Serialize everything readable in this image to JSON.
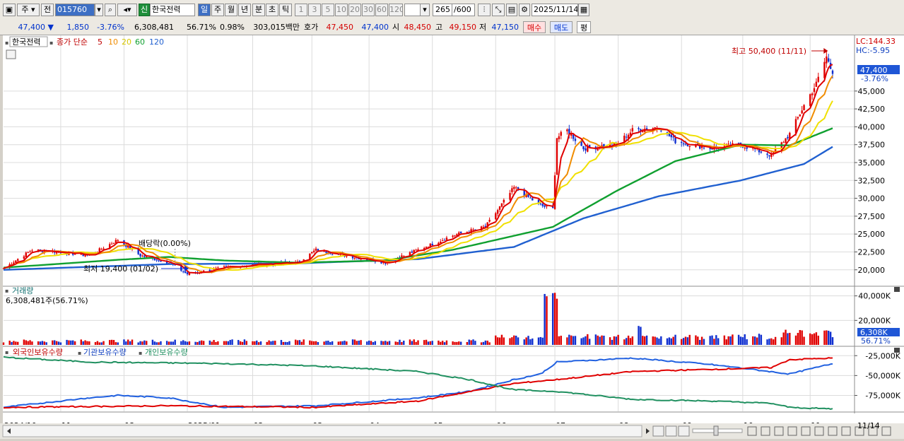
{
  "toolbar": {
    "mode_label": "주",
    "compare_label": "전",
    "code": "015760",
    "sin_badge": "신",
    "name": "한국전력",
    "periods": [
      "일",
      "주",
      "월",
      "년",
      "분",
      "초",
      "틱"
    ],
    "active_period": "일",
    "intervals": [
      "1",
      "3",
      "5",
      "10",
      "20",
      "30",
      "60",
      "120"
    ],
    "count": "265",
    "count_total": "/600",
    "date": "2025/11/14"
  },
  "quote": {
    "price": "47,400",
    "change": "1,850",
    "change_rate": "-3.76%",
    "volume": "6,308,481",
    "volume_ratio": "56.71%",
    "turnover_rate": "0.98%",
    "amount": "303,015백만",
    "hoga_label": "호가",
    "ask": "47,450",
    "bid": "47,400",
    "open_label": "시",
    "open": "48,450",
    "high_label": "고",
    "high": "49,150",
    "low_label": "저",
    "low": "47,150",
    "buy_label": "매수",
    "sell_label": "매도",
    "eval_label": "평"
  },
  "price_panel": {
    "stock_label": "한국전력",
    "ma_label": "종가 단순",
    "ma_periods": [
      "5",
      "10",
      "20",
      "60",
      "120"
    ],
    "lc": "LC:144.33",
    "hc": "HC:-5.95",
    "last_price": "47,400",
    "last_change": "-3.76%",
    "max_note": "최고 50,400 (11/11)",
    "min_note": "최저 19,400 (01/02)",
    "dividend_note": "배당락(0.00%)"
  },
  "volume_panel": {
    "title": "거래량",
    "value_text": "6,308,481주(56.71%)",
    "last_label": "6,308K",
    "last_ratio": "56.71%"
  },
  "investor_panel": {
    "titles": [
      "외국인보유수량",
      "기관보유수량",
      "개인보유수량"
    ]
  },
  "colors": {
    "ma5": "#e00000",
    "ma10": "#f08c00",
    "ma20": "#f0e000",
    "ma60": "#10a030",
    "ma120": "#2060d0",
    "up": "#e00000",
    "down": "#1030d0",
    "foreign": "#2060e0",
    "inst": "#e00000",
    "indiv": "#209060"
  },
  "chart_data": [
    {
      "type": "candlestick",
      "title": "한국전력",
      "y_ticks": [
        20000,
        22500,
        25000,
        27500,
        30000,
        32500,
        35000,
        37500,
        40000,
        42500,
        45000
      ],
      "ylim": [
        18000,
        52000
      ],
      "x_ticks": [
        "2024/10",
        "11",
        "12",
        "2025/01",
        "02",
        "03",
        "04",
        "05",
        "06",
        "07",
        "08",
        "09",
        "10",
        "11"
      ],
      "x_end_label": "11/14",
      "close_anchors": [
        [
          "2024/10/04",
          20200
        ],
        [
          "2024/10/18",
          22800
        ],
        [
          "2024/10/31",
          22500
        ],
        [
          "2024/11/15",
          22000
        ],
        [
          "2024/11/29",
          24200
        ],
        [
          "2024/12/10",
          22000
        ],
        [
          "2024/12/24",
          21000
        ],
        [
          "2025/01/02",
          19400
        ],
        [
          "2025/01/20",
          20300
        ],
        [
          "2025/02/05",
          20800
        ],
        [
          "2025/02/25",
          21000
        ],
        [
          "2025/03/06",
          22800
        ],
        [
          "2025/03/20",
          22000
        ],
        [
          "2025/04/09",
          21000
        ],
        [
          "2025/04/25",
          22800
        ],
        [
          "2025/05/12",
          24800
        ],
        [
          "2025/05/28",
          26000
        ],
        [
          "2025/06/11",
          31500
        ],
        [
          "2025/06/24",
          29000
        ],
        [
          "2025/06/30",
          28500
        ],
        [
          "2025/07/02",
          38500
        ],
        [
          "2025/07/07",
          39500
        ],
        [
          "2025/07/15",
          37000
        ],
        [
          "2025/07/31",
          37500
        ],
        [
          "2025/08/08",
          39500
        ],
        [
          "2025/08/21",
          40000
        ],
        [
          "2025/08/29",
          38000
        ],
        [
          "2025/09/15",
          37000
        ],
        [
          "2025/09/30",
          37500
        ],
        [
          "2025/10/15",
          36000
        ],
        [
          "2025/10/24",
          39000
        ],
        [
          "2025/10/31",
          43000
        ],
        [
          "2025/11/06",
          46000
        ],
        [
          "2025/11/11",
          49800
        ],
        [
          "2025/11/14",
          47400
        ]
      ],
      "ma60_anchors": [
        [
          "2024/10/04",
          20300
        ],
        [
          "2024/11/29",
          21400
        ],
        [
          "2024/12/24",
          21800
        ],
        [
          "2025/01/20",
          21300
        ],
        [
          "2025/02/25",
          21000
        ],
        [
          "2025/04/09",
          21300
        ],
        [
          "2025/05/12",
          22800
        ],
        [
          "2025/06/30",
          26000
        ],
        [
          "2025/07/31",
          31000
        ],
        [
          "2025/08/29",
          35200
        ],
        [
          "2025/09/30",
          37500
        ],
        [
          "2025/10/24",
          37400
        ],
        [
          "2025/11/14",
          39800
        ]
      ],
      "ma120_anchors": [
        [
          "2024/10/04",
          20000
        ],
        [
          "2024/12/24",
          20800
        ],
        [
          "2025/02/25",
          20900
        ],
        [
          "2025/04/25",
          21500
        ],
        [
          "2025/06/11",
          23200
        ],
        [
          "2025/07/15",
          27200
        ],
        [
          "2025/08/21",
          30300
        ],
        [
          "2025/09/30",
          32500
        ],
        [
          "2025/10/31",
          34800
        ],
        [
          "2025/11/14",
          37200
        ]
      ]
    },
    {
      "type": "bar",
      "title": "거래량",
      "y_ticks": [
        20000,
        40000
      ],
      "y_tick_labels": [
        "20,000K",
        "40,000K"
      ],
      "ylim": [
        0,
        45000
      ],
      "spikes": [
        [
          "2025/06/27",
          44000
        ],
        [
          "2025/06/30",
          39000
        ],
        [
          "2025/07/01",
          44000
        ],
        [
          "2025/08/11",
          17000
        ],
        [
          "2025/10/24",
          11000
        ],
        [
          "2025/11/11",
          12000
        ]
      ],
      "last_value_k": 6308
    },
    {
      "type": "line",
      "title": "외국인보유수량",
      "series": [
        {
          "name": "외국인보유수량",
          "anchors": [
            [
              "2024/10/04",
              -90000
            ],
            [
              "2024/11/15",
              -78000
            ],
            [
              "2024/11/29",
              -75000
            ],
            [
              "2024/12/24",
              -78000
            ],
            [
              "2025/01/20",
              -90000
            ],
            [
              "2025/03/06",
              -88000
            ],
            [
              "2025/04/25",
              -78000
            ],
            [
              "2025/05/20",
              -70000
            ],
            [
              "2025/06/11",
              -55000
            ],
            [
              "2025/06/24",
              -48000
            ],
            [
              "2025/07/02",
              -33000
            ],
            [
              "2025/08/08",
              -28000
            ],
            [
              "2025/09/15",
              -36000
            ],
            [
              "2025/10/24",
              -48000
            ],
            [
              "2025/11/14",
              -35000
            ]
          ]
        },
        {
          "name": "기관보유수량",
          "anchors": [
            [
              "2024/10/04",
              -90000
            ],
            [
              "2024/12/24",
              -88000
            ],
            [
              "2025/03/06",
              -90000
            ],
            [
              "2025/04/25",
              -82000
            ],
            [
              "2025/06/11",
              -60000
            ],
            [
              "2025/07/02",
              -55000
            ],
            [
              "2025/08/08",
              -45000
            ],
            [
              "2025/10/15",
              -40000
            ],
            [
              "2025/10/24",
              -30000
            ],
            [
              "2025/11/14",
              -28000
            ]
          ]
        },
        {
          "name": "개인보유수량",
          "anchors": [
            [
              "2024/10/04",
              -27000
            ],
            [
              "2024/11/15",
              -33000
            ],
            [
              "2025/01/20",
              -35000
            ],
            [
              "2025/03/06",
              -38000
            ],
            [
              "2025/04/25",
              -45000
            ],
            [
              "2025/05/20",
              -55000
            ],
            [
              "2025/06/11",
              -68000
            ],
            [
              "2025/07/02",
              -70000
            ],
            [
              "2025/08/08",
              -80000
            ],
            [
              "2025/09/15",
              -82000
            ],
            [
              "2025/10/15",
              -85000
            ],
            [
              "2025/10/24",
              -90000
            ],
            [
              "2025/11/14",
              -92000
            ]
          ]
        }
      ],
      "y_ticks": [
        -25000,
        -50000,
        -75000
      ],
      "y_tick_labels": [
        "-25,000K",
        "-50,000K",
        "-75,000K"
      ],
      "ylim": [
        -95000,
        -15000
      ]
    }
  ]
}
